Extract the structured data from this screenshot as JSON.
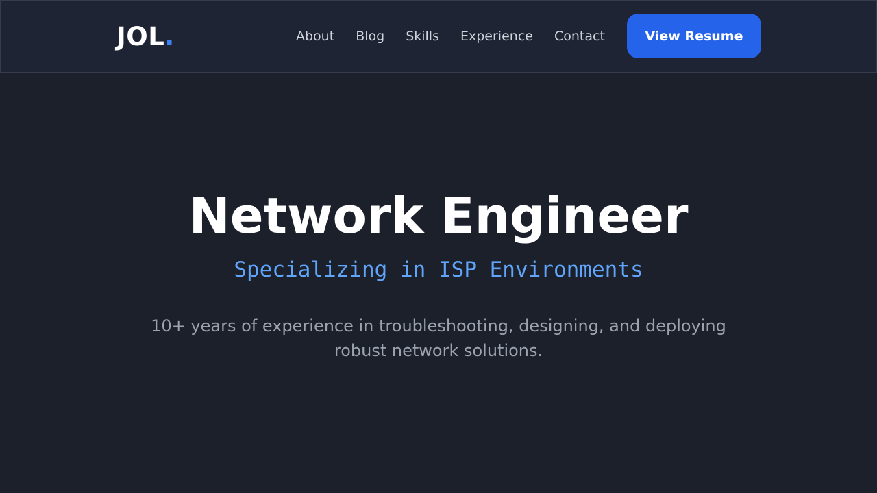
{
  "header": {
    "logo_text": "JOL",
    "logo_dot": ".",
    "nav": [
      {
        "label": "About"
      },
      {
        "label": "Blog"
      },
      {
        "label": "Skills"
      },
      {
        "label": "Experience"
      },
      {
        "label": "Contact"
      }
    ],
    "cta_label": "View Resume"
  },
  "hero": {
    "title": "Network Engineer",
    "subtitle": "Specializing in ISP Environments",
    "description": "10+ years of experience in troubleshooting, designing, and deploying robust network solutions."
  },
  "colors": {
    "background": "#1b202b",
    "header_background": "#1e2433",
    "accent": "#2563eb",
    "subtitle": "#60a5fa",
    "muted_text": "#9ca3af"
  }
}
